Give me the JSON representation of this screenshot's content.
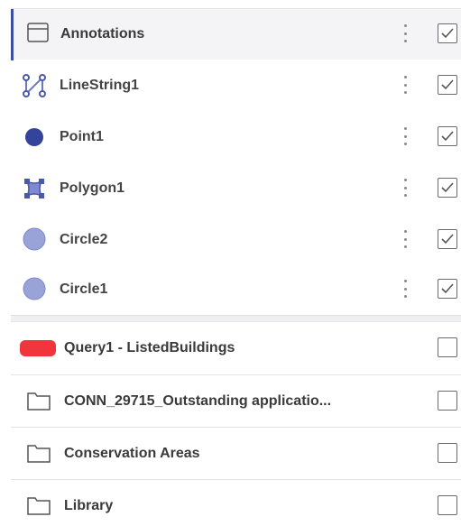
{
  "annotations_group": {
    "label": "Annotations",
    "checked": true,
    "items": [
      {
        "label": "LineString1",
        "icon": "linestring-icon",
        "checked": true
      },
      {
        "label": "Point1",
        "icon": "point-icon",
        "checked": true
      },
      {
        "label": "Polygon1",
        "icon": "polygon-icon",
        "checked": true
      },
      {
        "label": "Circle2",
        "icon": "circle-icon",
        "checked": true
      },
      {
        "label": "Circle1",
        "icon": "circle-icon",
        "checked": true
      }
    ]
  },
  "layers": [
    {
      "label": "Query1 - ListedBuildings",
      "icon": "query-layer-swatch-icon",
      "checked": false
    },
    {
      "label": "CONN_29715_Outstanding applicatio...",
      "icon": "folder-icon",
      "checked": false
    },
    {
      "label": "Conservation Areas",
      "icon": "folder-icon",
      "checked": false
    },
    {
      "label": "Library",
      "icon": "folder-icon",
      "checked": false
    }
  ],
  "colors": {
    "accent": "#3d4fa0",
    "point": "#34449a",
    "circle_fill": "#9aa3d8",
    "query_swatch": "#f0363c"
  }
}
